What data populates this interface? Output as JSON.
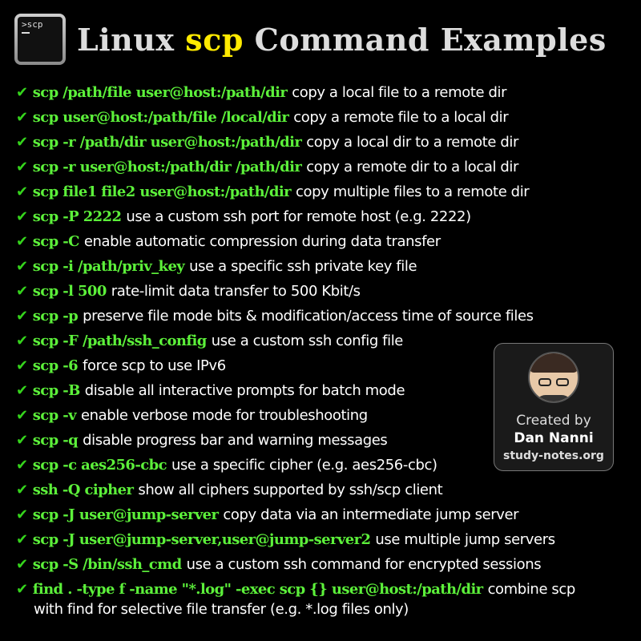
{
  "header": {
    "icon_text": ">scp",
    "title_pre": "Linux ",
    "title_hl": "scp",
    "title_post": " Command Examples",
    "highlight_color": "#ffea00"
  },
  "check_glyph": "✔",
  "items": [
    {
      "cmd": "scp /path/file user@host:/path/dir",
      "desc": "copy a local file to a remote dir"
    },
    {
      "cmd": "scp user@host:/path/file /local/dir",
      "desc": "copy a remote file to a local dir"
    },
    {
      "cmd": "scp -r /path/dir user@host:/path/dir",
      "desc": "copy a local dir to a remote dir"
    },
    {
      "cmd": "scp -r user@host:/path/dir /path/dir",
      "desc": "copy a remote dir to a local dir"
    },
    {
      "cmd": "scp file1 file2 user@host:/path/dir",
      "desc": "copy multiple files to a remote dir"
    },
    {
      "cmd": "scp -P 2222",
      "desc": "use a custom ssh port for remote host (e.g. 2222)"
    },
    {
      "cmd": "scp -C",
      "desc": "enable automatic compression during data transfer"
    },
    {
      "cmd": "scp -i /path/priv_key",
      "desc": "use a specific ssh private key file"
    },
    {
      "cmd": "scp -l 500",
      "desc": "rate-limit data transfer to 500 Kbit/s"
    },
    {
      "cmd": "scp -p",
      "desc": "preserve file mode bits & modification/access time of source files"
    },
    {
      "cmd": "scp -F /path/ssh_config",
      "desc": "use a custom ssh config file"
    },
    {
      "cmd": "scp -6",
      "desc": "force scp to use IPv6"
    },
    {
      "cmd": "scp -B",
      "desc": "disable all interactive prompts for batch mode"
    },
    {
      "cmd": "scp -v",
      "desc": "enable verbose mode for troubleshooting"
    },
    {
      "cmd": "scp -q",
      "desc": "disable progress bar and warning messages"
    },
    {
      "cmd": "scp -c aes256-cbc",
      "desc": "use a specific cipher (e.g. aes256-cbc)"
    },
    {
      "cmd": "ssh  -Q cipher",
      "desc": "show all ciphers supported by ssh/scp client"
    },
    {
      "cmd": "scp -J user@jump-server",
      "desc": "copy data via an intermediate jump server"
    },
    {
      "cmd": "scp -J user@jump-server,user@jump-server2",
      "desc": "use multiple jump servers"
    },
    {
      "cmd": "scp -S /bin/ssh_cmd",
      "desc": "use a custom ssh command for encrypted sessions"
    },
    {
      "cmd": "find . -type f -name \"*.log\" -exec scp {} user@host:/path/dir",
      "desc": "combine scp"
    }
  ],
  "last_item_continuation": "with find for selective file transfer (e.g. *.log files only)",
  "card": {
    "created_by": "Created by",
    "author": "Dan Nanni",
    "site": "study-notes.org"
  },
  "colors": {
    "background": "#000000",
    "command": "#5cf03a",
    "check": "#35d41c",
    "text": "#ffffff"
  }
}
